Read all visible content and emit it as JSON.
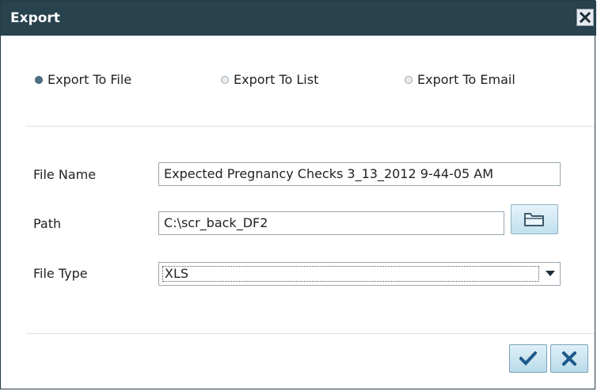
{
  "dialog": {
    "title": "Export",
    "close_icon": "close-x-icon"
  },
  "export_options": [
    {
      "label": "Export To File",
      "selected": true
    },
    {
      "label": "Export To List",
      "selected": false
    },
    {
      "label": "Export To Email",
      "selected": false
    }
  ],
  "form": {
    "file_name_label": "File Name",
    "file_name_value": "Expected Pregnancy Checks 3_13_2012 9-44-05 AM",
    "path_label": "Path",
    "path_value": "C:\\scr_back_DF2",
    "browse_icon": "folder-icon",
    "file_type_label": "File Type",
    "file_type_value": "XLS"
  },
  "actions": {
    "ok_icon": "checkmark-icon",
    "cancel_icon": "close-x-icon"
  },
  "colors": {
    "titlebar": "#28424e",
    "button_icon": "#1c5a8a"
  }
}
